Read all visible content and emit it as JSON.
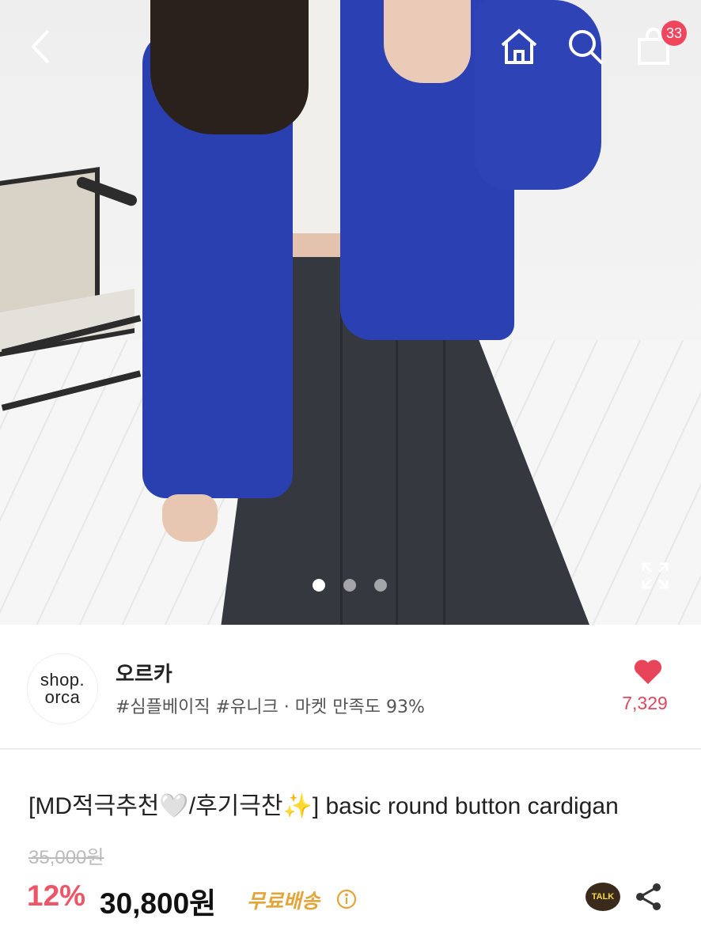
{
  "header": {
    "back_icon": "chevron-left-icon",
    "home_icon": "home-icon",
    "search_icon": "search-icon",
    "cart_icon": "shopping-bag-icon",
    "cart_count": "33"
  },
  "gallery": {
    "total_slides": 3,
    "active_index": 0,
    "expand_icon": "expand-icon"
  },
  "shop": {
    "logo_line1": "shop.",
    "logo_line2": "orca",
    "name": "오르카",
    "tags": "#심플베이직 #유니크 · 마켓 만족도 93%",
    "like_icon": "heart-icon",
    "likes": "7,329"
  },
  "product": {
    "title": "[MD적극추천🤍/후기극찬✨] basic round button cardigan",
    "original_price": "35,000원",
    "discount": "12%",
    "price": "30,800원",
    "shipping": "무료배송",
    "talk_label": "TALK"
  },
  "colors": {
    "accent": "#ee5566",
    "badge": "#f0455d",
    "shipping": "#e3a438"
  }
}
